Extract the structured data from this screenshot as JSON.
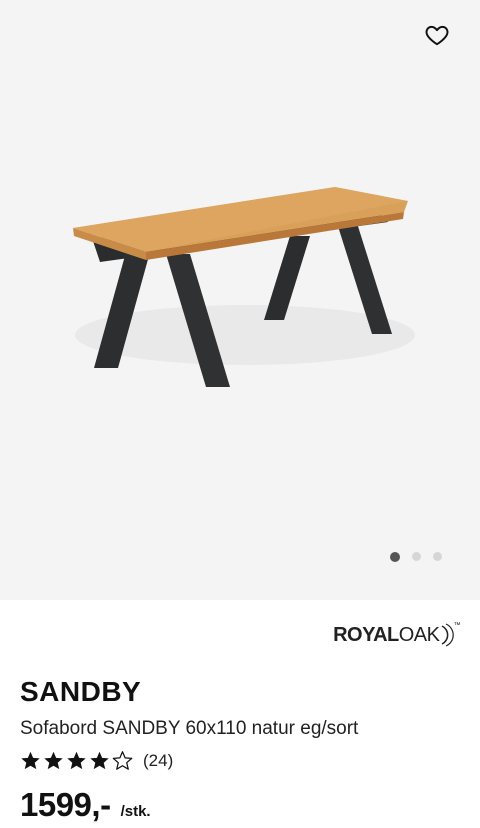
{
  "product": {
    "brand_bold": "ROYAL",
    "brand_light": "OAK",
    "brand_mark": "™",
    "name": "SANDBY",
    "description": "Sofabord SANDBY 60x110 natur eg/sort",
    "rating_stars": 4,
    "rating_max": 5,
    "rating_count": "(24)",
    "price": "1599,-",
    "unit": "/stk."
  },
  "gallery": {
    "image_count": 3,
    "active_index": 0
  },
  "icons": {
    "favorite": "heart-outline-icon",
    "star_filled": "star-filled-icon",
    "star_empty": "star-outline-icon"
  },
  "colors": {
    "gallery_bg": "#f4f4f4",
    "text": "#111111",
    "dot_active": "#555555",
    "dot_inactive": "#d6d6d6"
  }
}
